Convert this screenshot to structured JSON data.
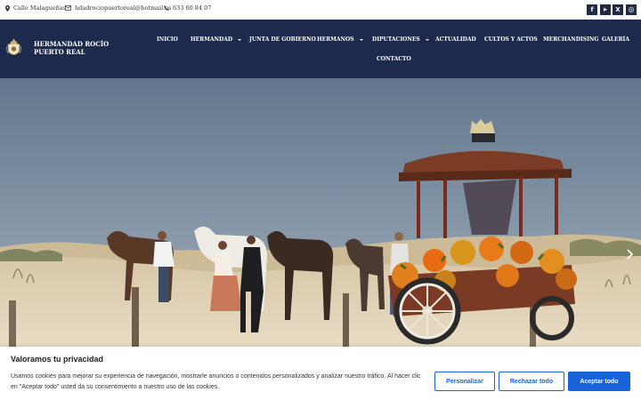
{
  "topbar": {
    "address": "Calle Malagueñas",
    "email": "hdadrociopuertoreal@hotmail.es",
    "phone": "633 60 84 07",
    "social": [
      {
        "icon": "facebook-icon",
        "glyph": "f"
      },
      {
        "icon": "youtube-icon",
        "glyph": "▶"
      },
      {
        "icon": "x-icon",
        "glyph": "X"
      },
      {
        "icon": "instagram-icon",
        "glyph": "◎"
      }
    ]
  },
  "header": {
    "brand": "HERMANDAD ROCÍO PUERTO REAL",
    "nav": [
      {
        "label": "INICIO"
      },
      {
        "label": "HERMANDAD"
      },
      {
        "label": "JUNTA DE GOBIERNO"
      },
      {
        "label": "HERMANOS"
      },
      {
        "label": "DIPUTACIONES"
      },
      {
        "label": "ACTUALIDAD"
      },
      {
        "label": "CULTOS Y ACTOS"
      },
      {
        "label": "MERCHANDISING"
      },
      {
        "label": "GALERÍA"
      },
      {
        "label": "CONTACTO"
      }
    ]
  },
  "hero": {
    "prev_icon": "chevron-left-icon",
    "next_icon": "chevron-right-icon"
  },
  "cookie": {
    "title": "Valoramos tu privacidad",
    "text": "Usamos cookies para mejorar su experiencia de navegación, mostrarle anuncios o contenidos personalizados y analizar nuestro tráfico. Al hacer clic en \"Aceptar todo\" usted da su consentimiento a nuestro uso de las cookies.",
    "customize": "Personalizar",
    "reject": "Rechazar todo",
    "accept": "Aceptar todo"
  },
  "colors": {
    "navbar": "#1d2a4d",
    "accent": "#1863dc",
    "social_bg": "#1f2b45"
  }
}
